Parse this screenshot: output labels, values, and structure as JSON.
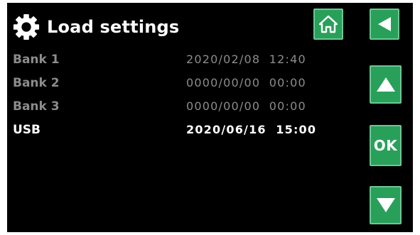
{
  "header": {
    "title": "Load settings"
  },
  "buttons": {
    "ok_label": "OK"
  },
  "colors": {
    "background": "#000000",
    "button_green": "#29a05a",
    "text_active": "#ffffff",
    "text_inactive": "#8c8c8c"
  },
  "icons": [
    "gear-icon",
    "home-icon",
    "back-arrow-icon",
    "up-arrow-icon",
    "down-arrow-icon"
  ],
  "banks": [
    {
      "label": "Bank 1",
      "date": "2020/02/08  12:40"
    },
    {
      "label": "Bank 2",
      "date": "0000/00/00  00:00"
    },
    {
      "label": "Bank 3",
      "date": "0000/00/00  00:00"
    },
    {
      "label": "USB",
      "date": "2020/06/16  15:00"
    }
  ]
}
